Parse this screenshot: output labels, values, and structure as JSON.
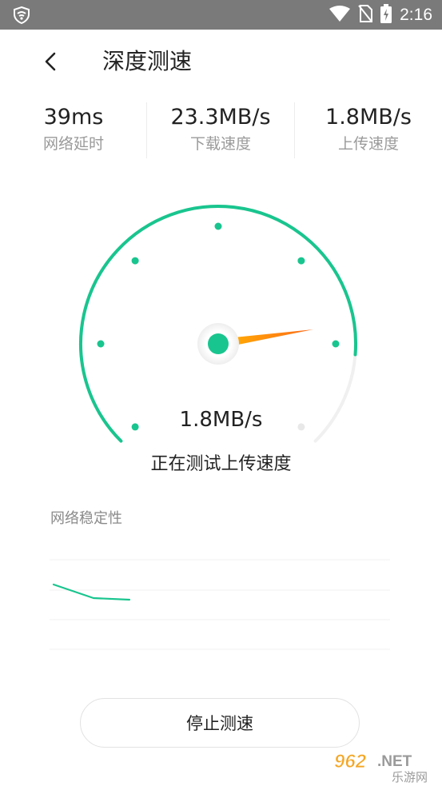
{
  "status_bar": {
    "time": "2:16",
    "icons": [
      "shield-app-icon",
      "wifi-icon",
      "no-sim-icon",
      "battery-charging-icon"
    ]
  },
  "header": {
    "title": "深度测速",
    "back_icon": "chevron-left-icon"
  },
  "stats": [
    {
      "value": "39ms",
      "label": "网络延时"
    },
    {
      "value": "23.3MB/s",
      "label": "下载速度"
    },
    {
      "value": "1.8MB/s",
      "label": "上传速度"
    }
  ],
  "gauge": {
    "current_speed": "1.8MB/s",
    "status": "正在测试上传速度",
    "accent_color": "#19C58E",
    "needle_color": "#FF7A1A",
    "progress_fraction": 0.85
  },
  "stability": {
    "title": "网络稳定性",
    "line_color": "#19C58E"
  },
  "actions": {
    "stop_label": "停止测速"
  },
  "watermark": {
    "text_top": "962.NET",
    "text_bottom": "乐游网"
  }
}
